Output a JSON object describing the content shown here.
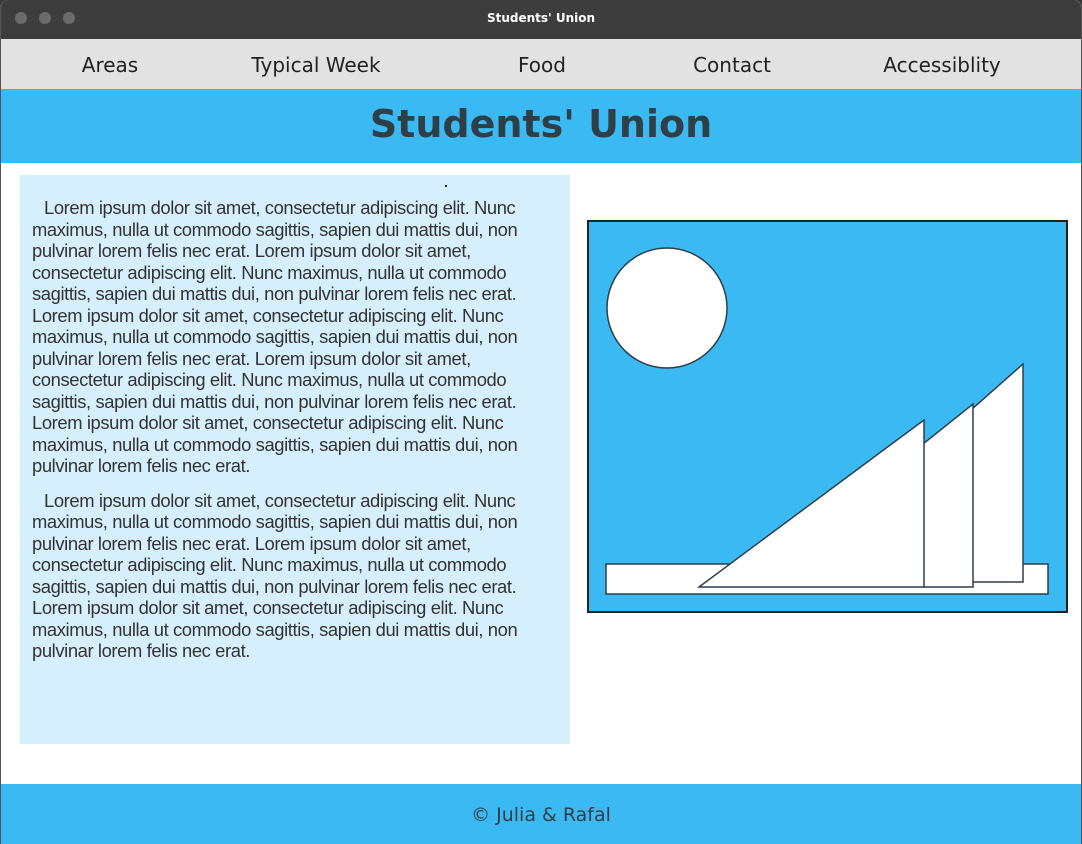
{
  "window": {
    "title": "Students' Union"
  },
  "nav": {
    "items": [
      {
        "label": "Areas"
      },
      {
        "label": "Typical Week"
      },
      {
        "label": "Food"
      },
      {
        "label": "Contact"
      },
      {
        "label": "Accessiblity"
      }
    ]
  },
  "header": {
    "title": "Students' Union"
  },
  "content": {
    "paragraphs": [
      "Lorem ipsum dolor sit amet, consectetur adipiscing elit. Nunc maximus, nulla ut commodo sagittis, sapien dui mattis dui, non pulvinar lorem felis nec erat. Lorem ipsum dolor sit amet, consectetur adipiscing elit. Nunc maximus, nulla ut commodo sagittis, sapien dui mattis dui, non pulvinar lorem felis nec erat. Lorem ipsum dolor sit amet, consectetur adipiscing elit. Nunc maximus, nulla ut commodo sagittis, sapien dui mattis dui, non pulvinar lorem felis nec erat. Lorem ipsum dolor sit amet, consectetur adipiscing elit. Nunc maximus, nulla ut commodo sagittis, sapien dui mattis dui, non pulvinar lorem felis nec erat. Lorem ipsum dolor sit amet, consectetur adipiscing elit. Nunc maximus, nulla ut commodo sagittis, sapien dui mattis dui, non pulvinar lorem felis nec erat.",
      "Lorem ipsum dolor sit amet, consectetur adipiscing elit. Nunc maximus, nulla ut commodo sagittis, sapien dui mattis dui, non pulvinar lorem felis nec erat. Lorem ipsum dolor sit amet, consectetur adipiscing elit. Nunc maximus, nulla ut commodo sagittis, sapien dui mattis dui, non pulvinar lorem felis nec erat. Lorem ipsum dolor sit amet, consectetur adipiscing elit. Nunc maximus, nulla ut commodo sagittis, sapien dui mattis dui, non pulvinar lorem felis nec erat."
    ]
  },
  "illustration": {
    "icon": "sailboat-and-sun-illustration"
  },
  "footer": {
    "text": "© Julia & Rafal"
  },
  "colors": {
    "accent": "#3bb9f2",
    "text_panel": "#d6effd",
    "nav_bg": "#e2e2e2",
    "heading_text": "#2e3f48"
  }
}
